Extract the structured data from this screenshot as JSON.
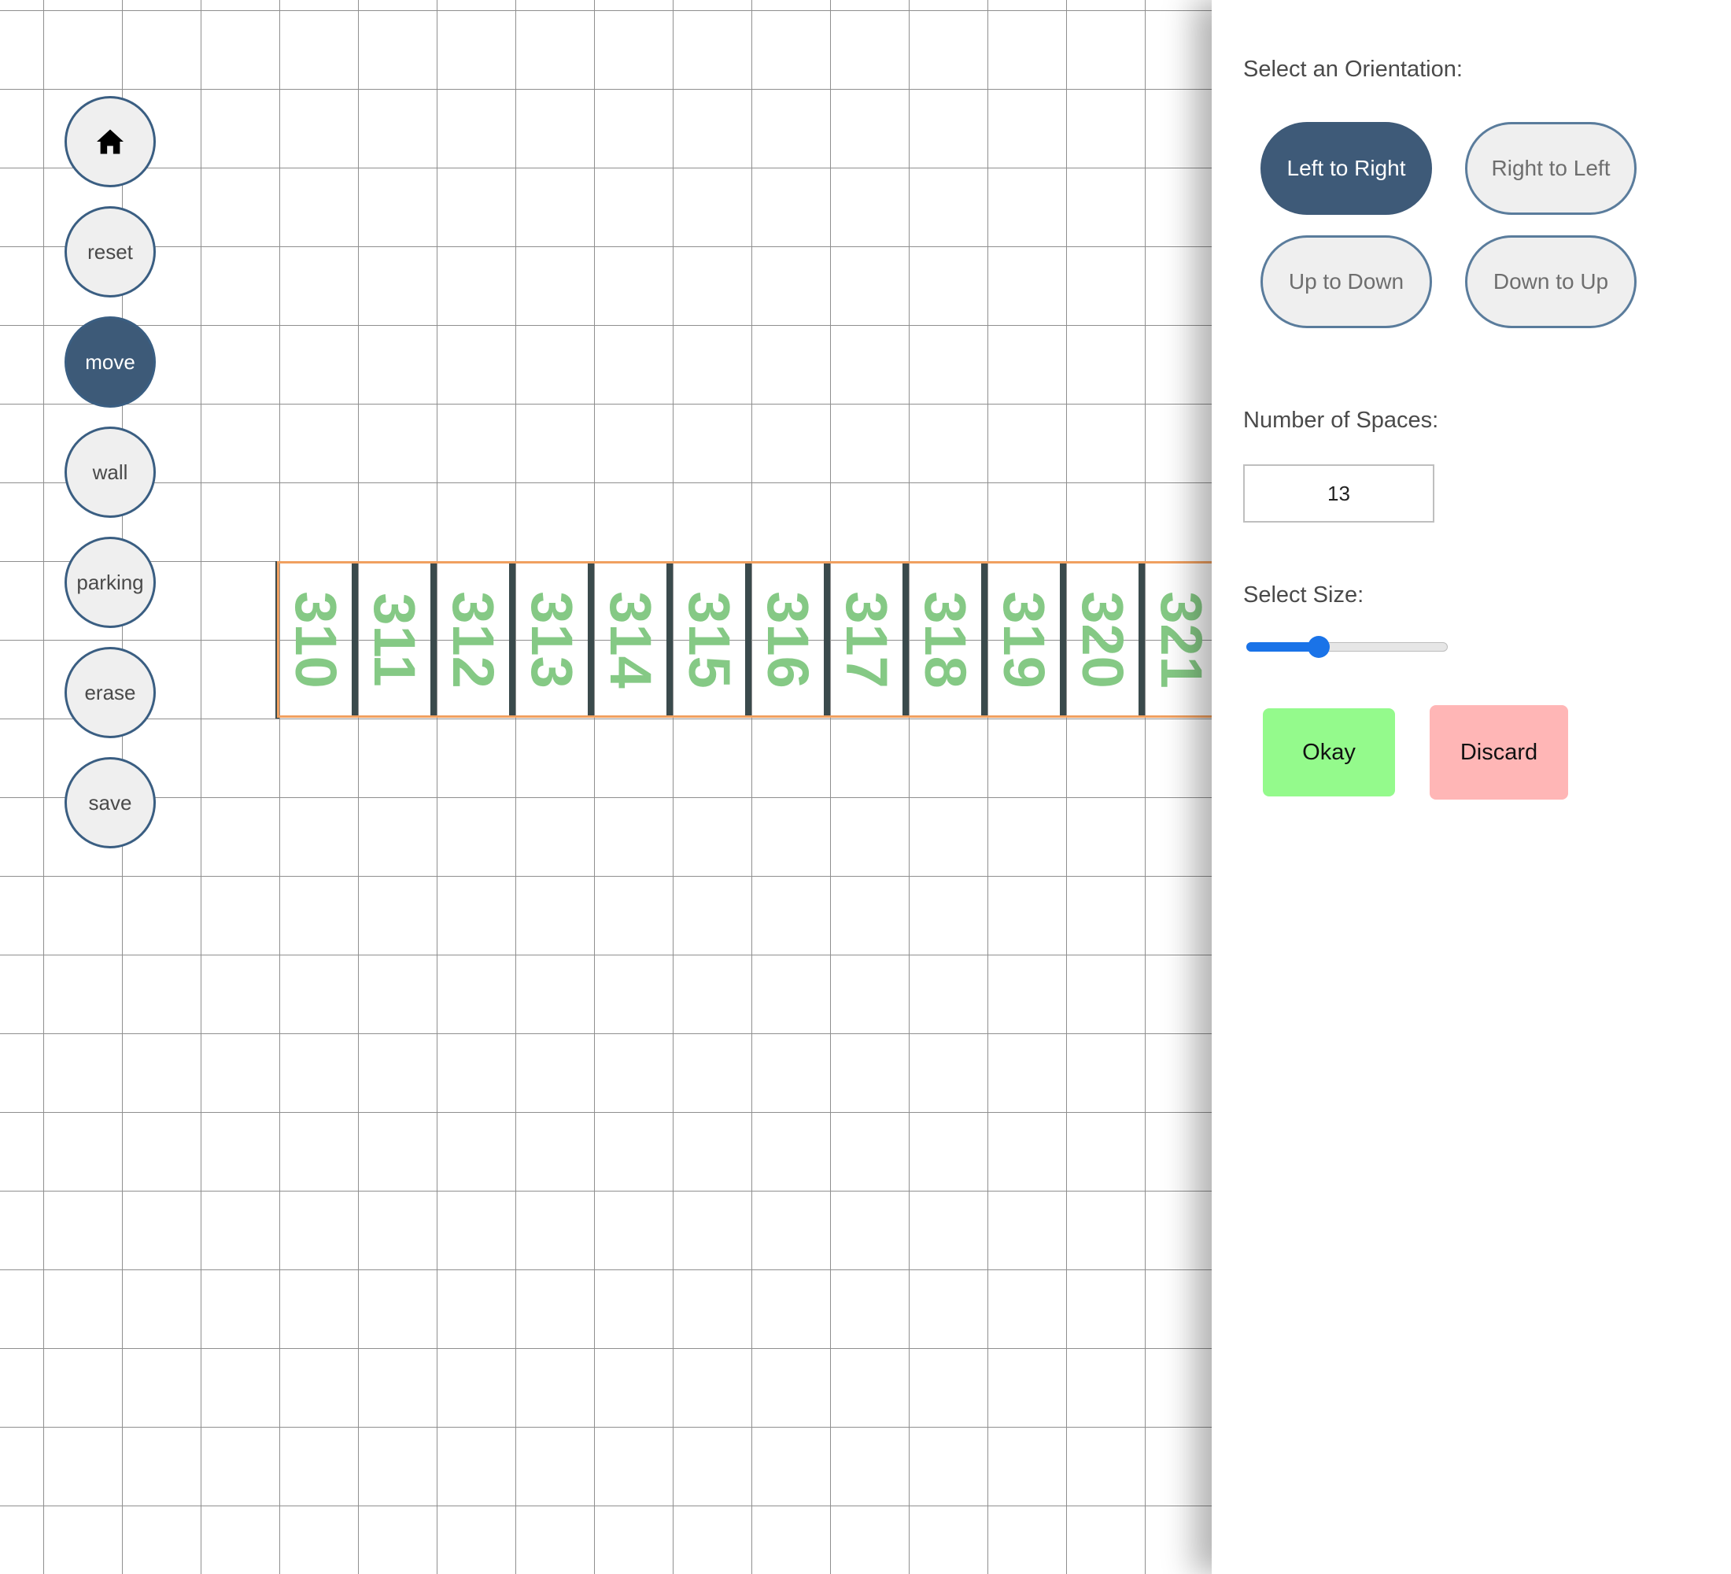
{
  "toolbar": {
    "home_icon": "home-icon",
    "items": [
      {
        "name": "reset-button",
        "label": "reset",
        "active": false
      },
      {
        "name": "move-button",
        "label": "move",
        "active": true
      },
      {
        "name": "wall-button",
        "label": "wall",
        "active": false
      },
      {
        "name": "parking-button",
        "label": "parking",
        "active": false
      },
      {
        "name": "erase-button",
        "label": "erase",
        "active": false
      },
      {
        "name": "save-button",
        "label": "save",
        "active": false
      }
    ]
  },
  "parking_row": {
    "spaces": [
      "310",
      "311",
      "312",
      "313",
      "314",
      "315",
      "316",
      "317",
      "318",
      "319",
      "320",
      "321"
    ],
    "label_color": "#85c985",
    "border_color": "#f0a060"
  },
  "panel": {
    "orientation_label": "Select an Orientation:",
    "orientations": [
      {
        "label": "Left to Right",
        "selected": true
      },
      {
        "label": "Right to Left",
        "selected": false
      },
      {
        "label": "Up to Down",
        "selected": false
      },
      {
        "label": "Down to Up",
        "selected": false
      }
    ],
    "spaces_label": "Number of Spaces:",
    "spaces_value": "13",
    "size_label": "Select Size:",
    "size_fraction": 0.36,
    "okay_label": "Okay",
    "discard_label": "Discard",
    "colors": {
      "accent": "#3d5a78",
      "okay": "#94fa8c",
      "discard": "#ffb6b6",
      "slider": "#1a73e8"
    }
  }
}
